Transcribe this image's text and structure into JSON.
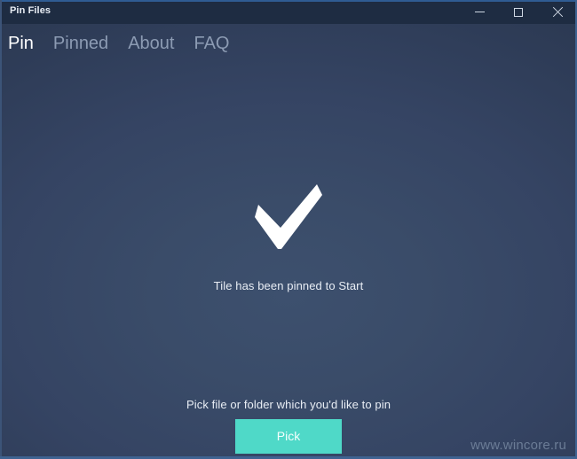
{
  "window": {
    "title": "Pin Files",
    "controls": {
      "minimize_name": "minimize-button",
      "maximize_name": "maximize-button",
      "close_name": "close-button"
    }
  },
  "nav": {
    "tabs": [
      {
        "label": "Pin",
        "active": true
      },
      {
        "label": "Pinned",
        "active": false
      },
      {
        "label": "About",
        "active": false
      },
      {
        "label": "FAQ",
        "active": false
      }
    ]
  },
  "main": {
    "status_icon": "checkmark-icon",
    "status_text": "Tile has been pinned to Start",
    "pick_hint": "Pick file or folder which you'd like to pin",
    "pick_button_label": "Pick"
  },
  "watermark": {
    "text": "www.wincore.ru"
  },
  "colors": {
    "titlebar": "#1e2c42",
    "background_center": "#3d506e",
    "background_edge": "#283549",
    "accent_button": "#4fd9c8",
    "tab_active": "#ffffff",
    "tab_inactive": "#8c9bb3",
    "text_primary": "#e9eef5",
    "watermark": "#6b7c96"
  }
}
